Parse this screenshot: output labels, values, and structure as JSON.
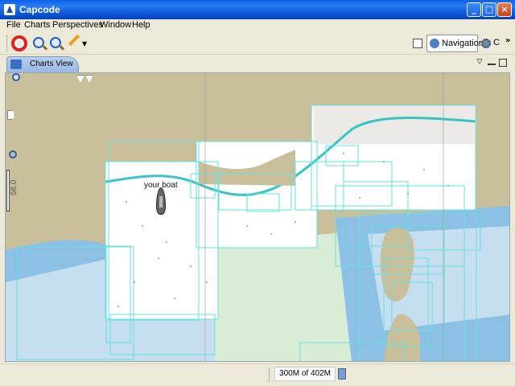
{
  "window": {
    "title": "Capcode"
  },
  "menu": [
    "File",
    "Charts",
    "Perspectives",
    "Window",
    "Help"
  ],
  "toolbar": {
    "navigation_label": "Navigation",
    "extra_label": "C",
    "more": "»"
  },
  "tab": {
    "label": "Charts View"
  },
  "map": {
    "boat_label": "your boat",
    "latitude_label": "58.0",
    "colors": {
      "land": "#c9c09b",
      "sea": "#c5def0",
      "sea_deep": "#8cc0e4",
      "chart_paper": "#ffffff",
      "chart_border": "#66e0e0",
      "coast": "#36c4c4"
    }
  },
  "status": {
    "memory": "300M of 402M"
  }
}
